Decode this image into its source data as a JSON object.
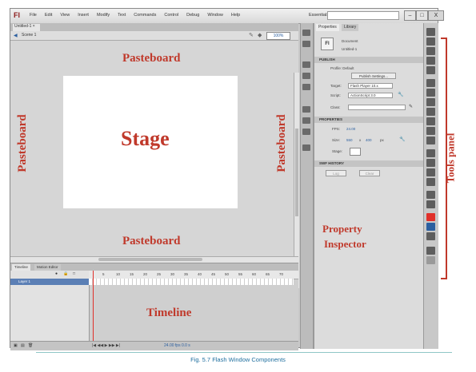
{
  "app": {
    "logo": "Fl",
    "workspace": "Essentials ▾"
  },
  "menu": [
    "File",
    "Edit",
    "View",
    "Insert",
    "Modify",
    "Text",
    "Commands",
    "Control",
    "Debug",
    "Window",
    "Help"
  ],
  "window_buttons": {
    "minimize": "–",
    "maximize": "□",
    "close": "X"
  },
  "document": {
    "tab": "Untitled-1 ×",
    "scene": "Scene 1",
    "zoom": "100%"
  },
  "labels": {
    "pasteboard_top": "Pasteboard",
    "pasteboard_bottom": "Pasteboard",
    "pasteboard_left": "Pasteboard",
    "pasteboard_right": "Pasteboard",
    "stage": "Stage",
    "timeline": "Timeline",
    "property_inspector_1": "Property",
    "property_inspector_2": "Inspector",
    "tools_panel": "Tools panel"
  },
  "properties": {
    "tabs": [
      "Properties",
      "Library"
    ],
    "doc_type": "Document",
    "doc_name": "Untitled-1",
    "publish_header": "PUBLISH",
    "profile": "Profile: Default",
    "publish_settings": "Publish Settings...",
    "target_label": "Target:",
    "target_value": "Flash Player 10.x",
    "script_label": "Script:",
    "script_value": "ActionScript 3.0",
    "class_label": "Class:",
    "properties_header": "PROPERTIES",
    "fps_label": "FPS:",
    "fps_value": "24.00",
    "size_label": "Size:",
    "size_w": "550",
    "size_x": "x",
    "size_h": "400",
    "size_unit": "px",
    "stage_label": "Stage:",
    "swf_history_header": "SWF HISTORY",
    "log_button": "Log",
    "clear_button": "Clear"
  },
  "timeline": {
    "tabs": [
      "Timeline",
      "Motion Editor"
    ],
    "layer_name": "Layer 1",
    "frame_numbers": [
      "5",
      "10",
      "15",
      "20",
      "25",
      "30",
      "35",
      "40",
      "45",
      "50",
      "55",
      "60",
      "65",
      "70"
    ],
    "status": "24.00 fps   0.0 s"
  },
  "caption": "Fig. 5.7  Flash Window Components",
  "colors": {
    "annotation": "#c0392b",
    "caption": "#1f6f9f"
  }
}
